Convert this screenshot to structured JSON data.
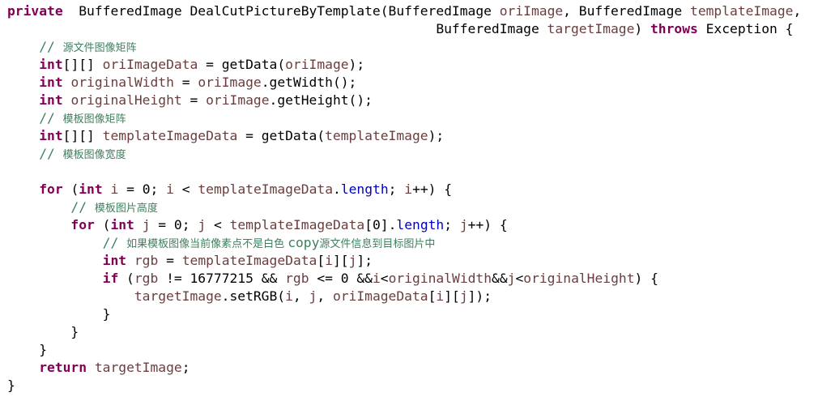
{
  "code_lines": [
    {
      "indent": 0,
      "tokens": [
        {
          "t": "kw",
          "v": "private"
        },
        {
          "t": "plain",
          "v": "  BufferedImage DealCutPictureByTemplate(BufferedImage "
        },
        {
          "t": "var",
          "v": "oriImage"
        },
        {
          "t": "plain",
          "v": ", BufferedImage "
        },
        {
          "t": "var",
          "v": "templateImage"
        },
        {
          "t": "plain",
          "v": ","
        }
      ]
    },
    {
      "indent": 0,
      "tokens": [
        {
          "t": "plain",
          "v": "                                                      BufferedImage "
        },
        {
          "t": "var",
          "v": "targetImage"
        },
        {
          "t": "plain",
          "v": ") "
        },
        {
          "t": "kw",
          "v": "throws"
        },
        {
          "t": "plain",
          "v": " Exception {"
        }
      ]
    },
    {
      "indent": 4,
      "tokens": [
        {
          "t": "cm",
          "v": "// "
        },
        {
          "t": "cm-cjk",
          "v": "源文件图像矩阵"
        }
      ]
    },
    {
      "indent": 4,
      "tokens": [
        {
          "t": "kw",
          "v": "int"
        },
        {
          "t": "plain",
          "v": "[][] "
        },
        {
          "t": "var",
          "v": "oriImageData"
        },
        {
          "t": "plain",
          "v": " = getData("
        },
        {
          "t": "var",
          "v": "oriImage"
        },
        {
          "t": "plain",
          "v": ");"
        }
      ]
    },
    {
      "indent": 4,
      "tokens": [
        {
          "t": "kw",
          "v": "int"
        },
        {
          "t": "plain",
          "v": " "
        },
        {
          "t": "var",
          "v": "originalWidth"
        },
        {
          "t": "plain",
          "v": " = "
        },
        {
          "t": "var",
          "v": "oriImage"
        },
        {
          "t": "plain",
          "v": ".getWidth();"
        }
      ]
    },
    {
      "indent": 4,
      "tokens": [
        {
          "t": "kw",
          "v": "int"
        },
        {
          "t": "plain",
          "v": " "
        },
        {
          "t": "var",
          "v": "originalHeight"
        },
        {
          "t": "plain",
          "v": " = "
        },
        {
          "t": "var",
          "v": "oriImage"
        },
        {
          "t": "plain",
          "v": ".getHeight();"
        }
      ]
    },
    {
      "indent": 4,
      "tokens": [
        {
          "t": "cm",
          "v": "// "
        },
        {
          "t": "cm-cjk",
          "v": "模板图像矩阵"
        }
      ]
    },
    {
      "indent": 4,
      "tokens": [
        {
          "t": "kw",
          "v": "int"
        },
        {
          "t": "plain",
          "v": "[][] "
        },
        {
          "t": "var",
          "v": "templateImageData"
        },
        {
          "t": "plain",
          "v": " = getData("
        },
        {
          "t": "var",
          "v": "templateImage"
        },
        {
          "t": "plain",
          "v": ");"
        }
      ]
    },
    {
      "indent": 4,
      "tokens": [
        {
          "t": "cm",
          "v": "// "
        },
        {
          "t": "cm-cjk",
          "v": "模板图像宽度"
        }
      ]
    },
    {
      "indent": 0,
      "tokens": []
    },
    {
      "indent": 4,
      "tokens": [
        {
          "t": "kw",
          "v": "for"
        },
        {
          "t": "plain",
          "v": " ("
        },
        {
          "t": "kw",
          "v": "int"
        },
        {
          "t": "plain",
          "v": " "
        },
        {
          "t": "var",
          "v": "i"
        },
        {
          "t": "plain",
          "v": " = 0; "
        },
        {
          "t": "var",
          "v": "i"
        },
        {
          "t": "plain",
          "v": " < "
        },
        {
          "t": "var",
          "v": "templateImageData"
        },
        {
          "t": "plain",
          "v": "."
        },
        {
          "t": "field",
          "v": "length"
        },
        {
          "t": "plain",
          "v": "; "
        },
        {
          "t": "var",
          "v": "i"
        },
        {
          "t": "plain",
          "v": "++) {"
        }
      ]
    },
    {
      "indent": 8,
      "tokens": [
        {
          "t": "cm",
          "v": "// "
        },
        {
          "t": "cm-cjk",
          "v": "模板图片高度"
        }
      ]
    },
    {
      "indent": 8,
      "tokens": [
        {
          "t": "kw",
          "v": "for"
        },
        {
          "t": "plain",
          "v": " ("
        },
        {
          "t": "kw",
          "v": "int"
        },
        {
          "t": "plain",
          "v": " "
        },
        {
          "t": "var",
          "v": "j"
        },
        {
          "t": "plain",
          "v": " = 0; "
        },
        {
          "t": "var",
          "v": "j"
        },
        {
          "t": "plain",
          "v": " < "
        },
        {
          "t": "var",
          "v": "templateImageData"
        },
        {
          "t": "plain",
          "v": "[0]."
        },
        {
          "t": "field",
          "v": "length"
        },
        {
          "t": "plain",
          "v": "; "
        },
        {
          "t": "var",
          "v": "j"
        },
        {
          "t": "plain",
          "v": "++) {"
        }
      ]
    },
    {
      "indent": 12,
      "tokens": [
        {
          "t": "cm",
          "v": "// "
        },
        {
          "t": "cm-cjk",
          "v": "如果模板图像当前像素点不是白色 "
        },
        {
          "t": "cm",
          "v": "copy"
        },
        {
          "t": "cm-cjk",
          "v": "源文件信息到目标图片中"
        }
      ]
    },
    {
      "indent": 12,
      "tokens": [
        {
          "t": "kw",
          "v": "int"
        },
        {
          "t": "plain",
          "v": " "
        },
        {
          "t": "var",
          "v": "rgb"
        },
        {
          "t": "plain",
          "v": " = "
        },
        {
          "t": "var",
          "v": "templateImageData"
        },
        {
          "t": "plain",
          "v": "["
        },
        {
          "t": "var",
          "v": "i"
        },
        {
          "t": "plain",
          "v": "]["
        },
        {
          "t": "var",
          "v": "j"
        },
        {
          "t": "plain",
          "v": "];"
        }
      ]
    },
    {
      "indent": 12,
      "tokens": [
        {
          "t": "kw",
          "v": "if"
        },
        {
          "t": "plain",
          "v": " ("
        },
        {
          "t": "var",
          "v": "rgb"
        },
        {
          "t": "plain",
          "v": " != 16777215 && "
        },
        {
          "t": "var",
          "v": "rgb"
        },
        {
          "t": "plain",
          "v": " <= 0 &&"
        },
        {
          "t": "var",
          "v": "i"
        },
        {
          "t": "plain",
          "v": "<"
        },
        {
          "t": "var",
          "v": "originalWidth"
        },
        {
          "t": "plain",
          "v": "&&"
        },
        {
          "t": "var",
          "v": "j"
        },
        {
          "t": "plain",
          "v": "<"
        },
        {
          "t": "var",
          "v": "originalHeight"
        },
        {
          "t": "plain",
          "v": ") {"
        }
      ]
    },
    {
      "indent": 16,
      "tokens": [
        {
          "t": "var",
          "v": "targetImage"
        },
        {
          "t": "plain",
          "v": ".setRGB("
        },
        {
          "t": "var",
          "v": "i"
        },
        {
          "t": "plain",
          "v": ", "
        },
        {
          "t": "var",
          "v": "j"
        },
        {
          "t": "plain",
          "v": ", "
        },
        {
          "t": "var",
          "v": "oriImageData"
        },
        {
          "t": "plain",
          "v": "["
        },
        {
          "t": "var",
          "v": "i"
        },
        {
          "t": "plain",
          "v": "]["
        },
        {
          "t": "var",
          "v": "j"
        },
        {
          "t": "plain",
          "v": "]);"
        }
      ]
    },
    {
      "indent": 12,
      "tokens": [
        {
          "t": "plain",
          "v": "}"
        }
      ]
    },
    {
      "indent": 8,
      "tokens": [
        {
          "t": "plain",
          "v": "}"
        }
      ]
    },
    {
      "indent": 4,
      "tokens": [
        {
          "t": "plain",
          "v": "}"
        }
      ]
    },
    {
      "indent": 4,
      "tokens": [
        {
          "t": "kw",
          "v": "return"
        },
        {
          "t": "plain",
          "v": " "
        },
        {
          "t": "var",
          "v": "targetImage"
        },
        {
          "t": "plain",
          "v": ";"
        }
      ]
    },
    {
      "indent": 0,
      "tokens": [
        {
          "t": "plain",
          "v": "}"
        }
      ]
    }
  ],
  "colors": {
    "keyword": "#7f0055",
    "variable": "#6a3e3e",
    "field": "#0000c0",
    "comment": "#3f7f5f",
    "text": "#000000",
    "background": "#ffffff"
  }
}
